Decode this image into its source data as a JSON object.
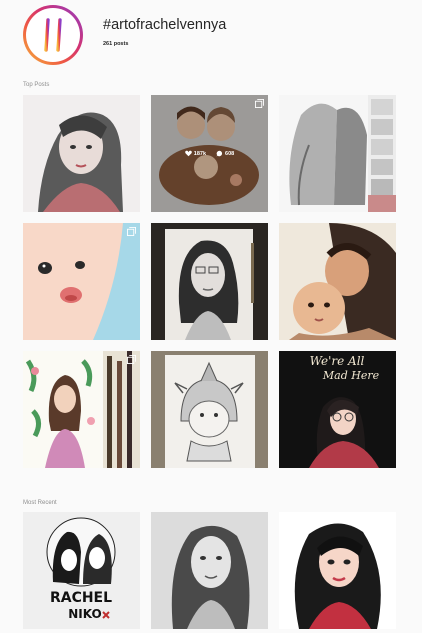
{
  "hashtag": {
    "title": "#artofrachelvennya",
    "post_count": "261 posts"
  },
  "sections": {
    "top_posts_label": "Top Posts",
    "most_recent_label": "Most Recent"
  },
  "top_posts": [
    {
      "alt": "grayscale portrait of woman with long hair, rose tint",
      "multi": false
    },
    {
      "alt": "painted family portrait of couple with baby",
      "multi": true,
      "likes": "187k",
      "comments": "608"
    },
    {
      "alt": "process sketch of long hair with thumbnails strip",
      "multi": false
    },
    {
      "alt": "digital drawing of baby face on blue background",
      "multi": true
    },
    {
      "alt": "pencil portrait of woman with glasses",
      "multi": false
    },
    {
      "alt": "colored portrait of father with baby",
      "multi": false
    },
    {
      "alt": "watercolor portrait of woman with flamingos and leaves",
      "multi": true
    },
    {
      "alt": "pencil sketch of baby in dinosaur hood",
      "multi": false
    },
    {
      "alt": "illustration of woman with glasses, text We're All Mad Here",
      "multi": false,
      "caption_line1": "We're All",
      "caption_line2": "Mad Here"
    }
  ],
  "most_recent": [
    {
      "alt": "ink drawing of couple with names Rachel Niko",
      "multi": false
    },
    {
      "alt": "pencil portrait of woman with long hair",
      "multi": false
    },
    {
      "alt": "vector portrait of woman with dark wavy hair",
      "multi": false
    }
  ],
  "colors": {
    "background": "#fafafa",
    "text_primary": "#262626",
    "text_secondary": "#8e8e8e",
    "gradient": [
      "#f6b73c",
      "#ef5a43",
      "#d5336f",
      "#8e3ec6"
    ]
  },
  "icons": {
    "hashtag": "hashtag-icon",
    "multiple": "multiple-posts-icon",
    "heart": "heart-icon",
    "comment": "comment-icon"
  }
}
